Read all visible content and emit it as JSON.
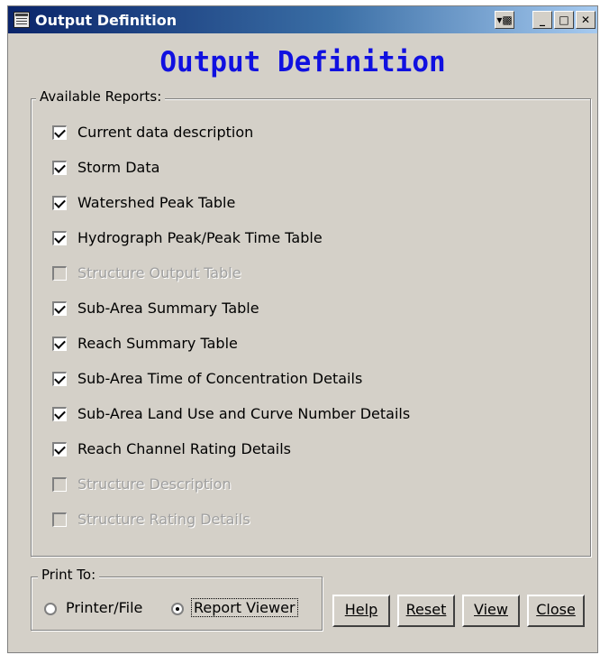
{
  "window": {
    "title": "Output Definition"
  },
  "heading": "Output Definition",
  "reports": {
    "legend": "Available Reports:",
    "items": [
      {
        "label": "Current data description",
        "checked": true,
        "enabled": true
      },
      {
        "label": "Storm Data",
        "checked": true,
        "enabled": true
      },
      {
        "label": "Watershed Peak Table",
        "checked": true,
        "enabled": true
      },
      {
        "label": "Hydrograph Peak/Peak Time Table",
        "checked": true,
        "enabled": true
      },
      {
        "label": "Structure Output Table",
        "checked": false,
        "enabled": false
      },
      {
        "label": "Sub-Area Summary Table",
        "checked": true,
        "enabled": true
      },
      {
        "label": "Reach Summary Table",
        "checked": true,
        "enabled": true
      },
      {
        "label": "Sub-Area Time of Concentration Details",
        "checked": true,
        "enabled": true
      },
      {
        "label": "Sub-Area Land Use and Curve Number Details",
        "checked": true,
        "enabled": true
      },
      {
        "label": "Reach Channel Rating Details",
        "checked": true,
        "enabled": true
      },
      {
        "label": "Structure Description",
        "checked": false,
        "enabled": false
      },
      {
        "label": "Structure Rating Details",
        "checked": false,
        "enabled": false
      }
    ]
  },
  "print_to": {
    "legend": "Print To:",
    "options": [
      {
        "label": "Printer/File",
        "selected": false
      },
      {
        "label": "Report Viewer",
        "selected": true
      }
    ]
  },
  "buttons": {
    "help": "Help",
    "reset": "Reset",
    "view": "View",
    "close": "Close"
  }
}
